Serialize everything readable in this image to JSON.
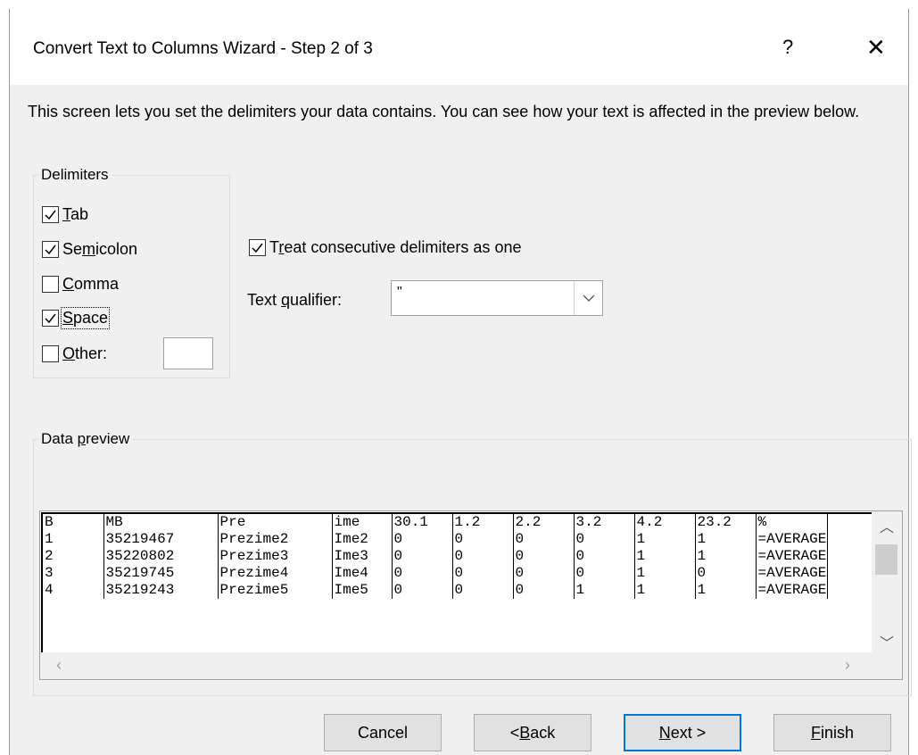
{
  "window": {
    "title": "Convert Text to Columns Wizard - Step 2 of 3",
    "help_glyph": "?",
    "close_glyph": "✕"
  },
  "intro_text": "This screen lets you set the delimiters your data contains.  You can see how your text is affected in the preview below.",
  "delimiters": {
    "legend": "Delimiters",
    "tab": {
      "label": "Tab",
      "checked": true
    },
    "semicolon": {
      "label": "Semicolon",
      "checked": true
    },
    "comma": {
      "label": "Comma",
      "checked": false
    },
    "space": {
      "label": "Space",
      "checked": true
    },
    "other": {
      "label": "Other:",
      "checked": false,
      "value": ""
    }
  },
  "treat_consecutive": {
    "label": "Treat consecutive delimiters as one",
    "checked": true
  },
  "text_qualifier": {
    "label": "Text qualifier:",
    "value": "\""
  },
  "data_preview": {
    "legend": "Data preview",
    "rows": [
      [
        "B",
        "MB",
        "Pre",
        "ime",
        "30.1",
        "1.2",
        "2.2",
        "3.2",
        "4.2",
        "23.2",
        "%"
      ],
      [
        "1",
        "35219467",
        "Prezime2",
        "Ime2",
        "0",
        "0",
        "0",
        "0",
        "1",
        "1",
        "=AVERAGE"
      ],
      [
        "2",
        "35220802",
        "Prezime3",
        "Ime3",
        "0",
        "0",
        "0",
        "0",
        "1",
        "1",
        "=AVERAGE"
      ],
      [
        "3",
        "35219745",
        "Prezime4",
        "Ime4",
        "0",
        "0",
        "0",
        "0",
        "1",
        "0",
        "=AVERAGE"
      ],
      [
        "4",
        "35219243",
        "Prezime5",
        "Ime5",
        "0",
        "0",
        "0",
        "1",
        "1",
        "1",
        "=AVERAGE"
      ]
    ]
  },
  "buttons": {
    "cancel": "Cancel",
    "back": "< Back",
    "next": "Next >",
    "finish": "Finish"
  },
  "colors": {
    "dialog_background": "#f0f0f0",
    "default_button_border": "#0078d7",
    "button_face": "#e1e1e1"
  }
}
